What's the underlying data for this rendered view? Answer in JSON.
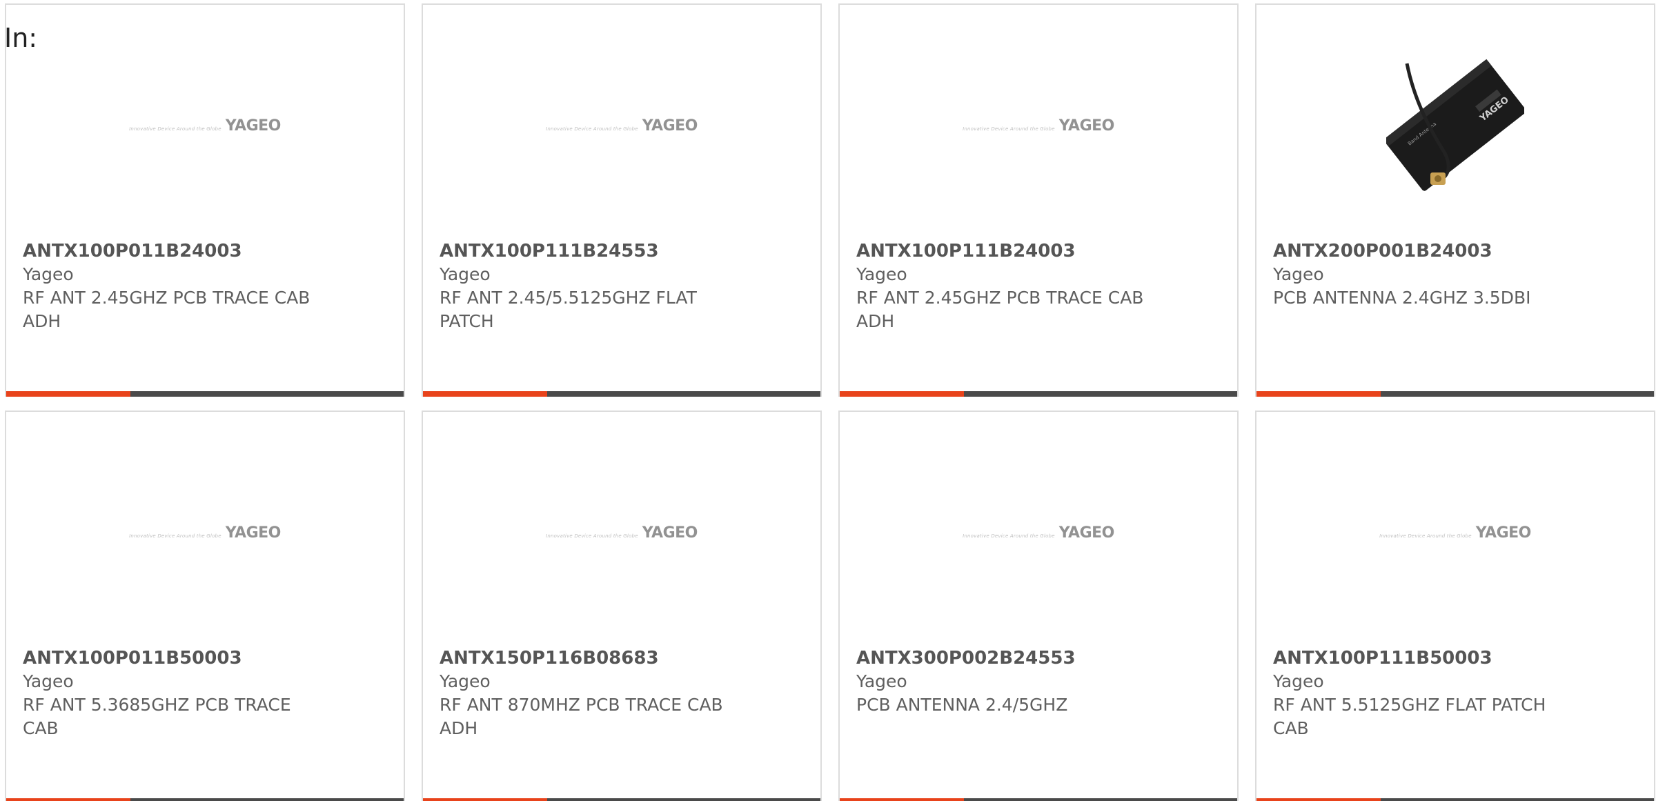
{
  "prefix": "In:",
  "brand": {
    "tagline": "Innovative Device Around the Globe",
    "wordmark": "YAGEO",
    "accent_color": "#e8431b",
    "bar_color": "#4a4a4a"
  },
  "products": [
    {
      "part_number": "ANTX100P011B24003",
      "manufacturer": "Yageo",
      "description": "RF ANT 2.45GHZ PCB TRACE CAB ADH",
      "image": "yageo-logo-placeholder"
    },
    {
      "part_number": "ANTX100P111B24553",
      "manufacturer": "Yageo",
      "description": "RF ANT 2.45/5.5125GHZ FLAT PATCH",
      "image": "yageo-logo-placeholder"
    },
    {
      "part_number": "ANTX100P111B24003",
      "manufacturer": "Yageo",
      "description": "RF ANT 2.45GHZ PCB TRACE CAB ADH",
      "image": "yageo-logo-placeholder"
    },
    {
      "part_number": "ANTX200P001B24003",
      "manufacturer": "Yageo",
      "description": "PCB ANTENNA 2.4GHZ 3.5DBI",
      "image": "antenna-product-photo"
    },
    {
      "part_number": "ANTX100P011B50003",
      "manufacturer": "Yageo",
      "description": "RF ANT 5.3685GHZ PCB TRACE CAB",
      "image": "yageo-logo-placeholder"
    },
    {
      "part_number": "ANTX150P116B08683",
      "manufacturer": "Yageo",
      "description": "RF ANT 870MHZ PCB TRACE CAB ADH",
      "image": "yageo-logo-placeholder"
    },
    {
      "part_number": "ANTX300P002B24553",
      "manufacturer": "Yageo",
      "description": "PCB ANTENNA 2.4/5GHZ",
      "image": "yageo-logo-placeholder"
    },
    {
      "part_number": "ANTX100P111B50003",
      "manufacturer": "Yageo",
      "description": "RF ANT 5.5125GHZ FLAT PATCH CAB",
      "image": "yageo-logo-placeholder"
    }
  ]
}
